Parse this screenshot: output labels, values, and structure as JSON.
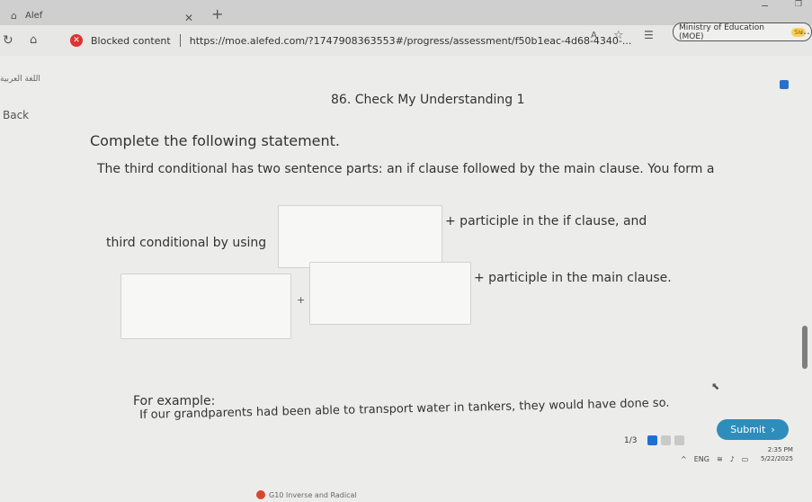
{
  "browser": {
    "tab_title": "Alef",
    "tab_favicon": "home-icon",
    "address": {
      "blocked_label": "Blocked content",
      "url": "https://moe.alefed.com/?1747908363553#/progress/assessment/f50b1eac-4d68-4340-..."
    },
    "profile_label": "Ministry of Education (MOE)",
    "profile_badge": "SH"
  },
  "course_title": "اللغة العربية",
  "back_label": "Back",
  "page_title": "86. Check My Understanding 1",
  "instruction": "Complete the following statement.",
  "statement_line1": "The third conditional has two sentence parts: an if clause followed by the main clause. You form a",
  "label_third_conditional": "third conditional by using",
  "participle_if": "+ participle in the if clause, and",
  "plus": "+",
  "participle_main": "+ participle in the main clause.",
  "for_example": "For example:",
  "example_sentence": "If our grandparents had been able to transport water in tankers, they would have done so.",
  "pager": "1/3",
  "submit_label": "Submit",
  "tray": {
    "lang": "ENG",
    "time": "2:35 PM",
    "date": "5/22/2025"
  },
  "taskbar_item": "G10 Inverse and Radical",
  "colors": {
    "accent": "#2f8dbc",
    "active_dot": "#1f6fd1",
    "blocked": "#dd3333"
  }
}
